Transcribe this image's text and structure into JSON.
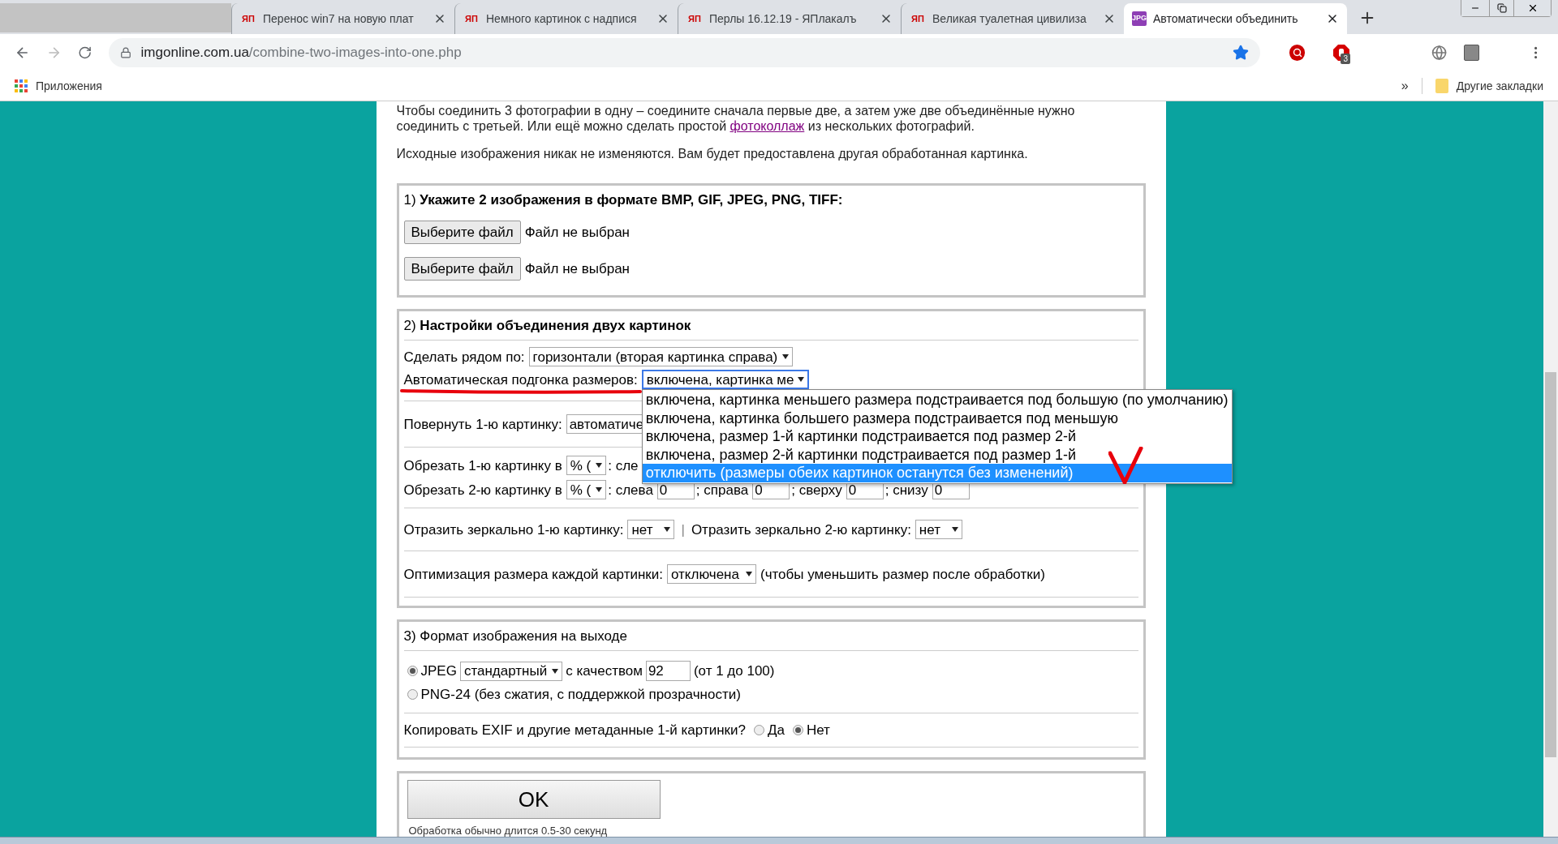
{
  "tabs": [
    {
      "kind": "blank",
      "selected": false
    },
    {
      "kind": "page",
      "favicon": {
        "kind": "yap",
        "text": "ЯП"
      },
      "title": "Перенос win7 на новую плат",
      "selected": false
    },
    {
      "kind": "page",
      "favicon": {
        "kind": "yap",
        "text": "ЯП"
      },
      "title": "Немного картинок с надпися",
      "selected": false
    },
    {
      "kind": "page",
      "favicon": {
        "kind": "yap",
        "text": "ЯП"
      },
      "title": "Перлы 16.12.19 - ЯПлакалъ",
      "selected": false
    },
    {
      "kind": "page",
      "favicon": {
        "kind": "yap",
        "text": "ЯП"
      },
      "title": "Великая туалетная цивилиза",
      "selected": false
    },
    {
      "kind": "page",
      "favicon": {
        "kind": "jpg",
        "text": "JPG"
      },
      "title": "Автоматически объединить",
      "selected": true
    }
  ],
  "toolbar": {
    "back": {
      "disabled": false
    },
    "forward": {
      "disabled": true
    },
    "url": {
      "host": "imgonline.com.ua",
      "path": "/combine-two-images-into-one.php"
    },
    "bookmarked": true,
    "extension_badge": "3"
  },
  "bookmarks": {
    "apps_label": "Приложения",
    "overflow": "»",
    "folder": "Другие закладки"
  },
  "intro": [
    {
      "before": "Чтобы соединить 3 фотографии в одну – соедините сначала первые две, а затем уже две объединённые нужно соединить с третьей. Или ещё можно сделать простой ",
      "link": "фотоколлаж",
      "after": " из нескольких фотографий."
    },
    {
      "before": "Исходные изображения никак не изменяются. Вам будет предоставлена другая обработанная картинка."
    }
  ],
  "section1": {
    "number": "1)",
    "title": "Укажите 2 изображения в формате BMP, GIF, JPEG, PNG, TIFF:",
    "title_bold": true,
    "files": [
      {
        "button": "Выберите файл",
        "status": "Файл не выбран"
      },
      {
        "button": "Выберите файл",
        "status": "Файл не выбран"
      }
    ]
  },
  "section2": {
    "number": "2)",
    "title": "Настройки объединения двух картинок",
    "title_bold": true,
    "side_by": {
      "label": "Сделать рядом по:",
      "value": "горизонтали (вторая картинка справа)"
    },
    "auto_fit": {
      "label": "Автоматическая подгонка размеров:",
      "value": "включена, картинка ме",
      "expanded": true,
      "options": [
        {
          "label": "включена, картинка меньшего размера подстраивается под большую (по умолчанию)",
          "selected": false
        },
        {
          "label": "включена, картинка большего размера подстраивается под меньшую",
          "selected": false
        },
        {
          "label": "включена, размер 1-й картинки подстраивается под размер 2-й",
          "selected": false
        },
        {
          "label": "включена, размер 2-й картинки подстраивается под размер 1-й",
          "selected": false
        },
        {
          "label": "отключить (размеры обеих картинок останутся без изменений)",
          "selected": true
        }
      ]
    },
    "rotate": {
      "label": "Повернуть 1-ю картинку:",
      "value": "автоматиче"
    },
    "crops": [
      {
        "label": "Обрезать 1-ю картинку в",
        "unit": "% (",
        "fields": [
          {
            "label": ": сле"
          }
        ]
      },
      {
        "label": "Обрезать 2-ю картинку в",
        "unit": "% (",
        "fields": [
          {
            "label": ": слева",
            "value": "0"
          },
          {
            "label": "; справа",
            "value": "0"
          },
          {
            "label": "; сверху",
            "value": "0"
          },
          {
            "label": "; снизу",
            "value": "0"
          }
        ]
      }
    ],
    "mirror": [
      {
        "label": "Отразить зеркально 1-ю картинку:",
        "value": "нет"
      },
      {
        "label": "Отразить зеркально 2-ю картинку:",
        "value": "нет"
      }
    ],
    "mirror_separator": "|",
    "optimize": {
      "label": "Оптимизация размера каждой картинки:",
      "value": "отключена",
      "note": "(чтобы уменьшить размер после обработки)"
    }
  },
  "section3": {
    "number": "3)",
    "title": "Формат изображения на выходе",
    "title_bold": false,
    "formats": [
      {
        "kind": "jpeg",
        "label": "JPEG",
        "selected": true,
        "mode": "стандартный",
        "quality_label": "с качеством",
        "quality": "92",
        "range": "(от 1 до 100)"
      },
      {
        "kind": "png",
        "label": "PNG-24 (без сжатия, с поддержкой прозрачности)",
        "selected": false
      }
    ],
    "exif": {
      "label": "Копировать EXIF и другие метаданные 1-й картинки?",
      "options": [
        {
          "label": "Да",
          "selected": false
        },
        {
          "label": "Нет",
          "selected": true
        }
      ]
    }
  },
  "submit": {
    "button": "OK",
    "note": "Обработка обычно длится 0.5-30 секунд"
  }
}
